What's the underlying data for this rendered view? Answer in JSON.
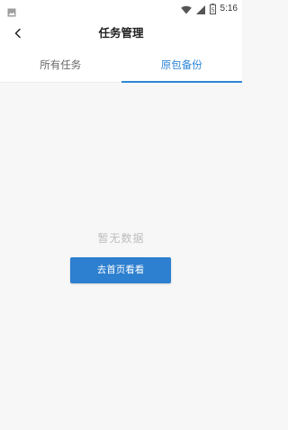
{
  "status_bar": {
    "time": "5:16",
    "battery_level": "5",
    "icons": [
      "image-icon",
      "wifi-icon",
      "signal-icon",
      "battery-icon"
    ]
  },
  "header": {
    "title": "任务管理",
    "back_icon": "chevron-left-icon"
  },
  "tabs": [
    {
      "label": "所有任务",
      "active": false
    },
    {
      "label": "原包备份",
      "active": true
    }
  ],
  "empty_state": {
    "message": "暂无数据",
    "button_label": "去首页看看"
  },
  "colors": {
    "accent": "#2f86d6",
    "button": "#2d7fcf",
    "background": "#f7f7f7",
    "empty_text": "#bdbdbd"
  }
}
